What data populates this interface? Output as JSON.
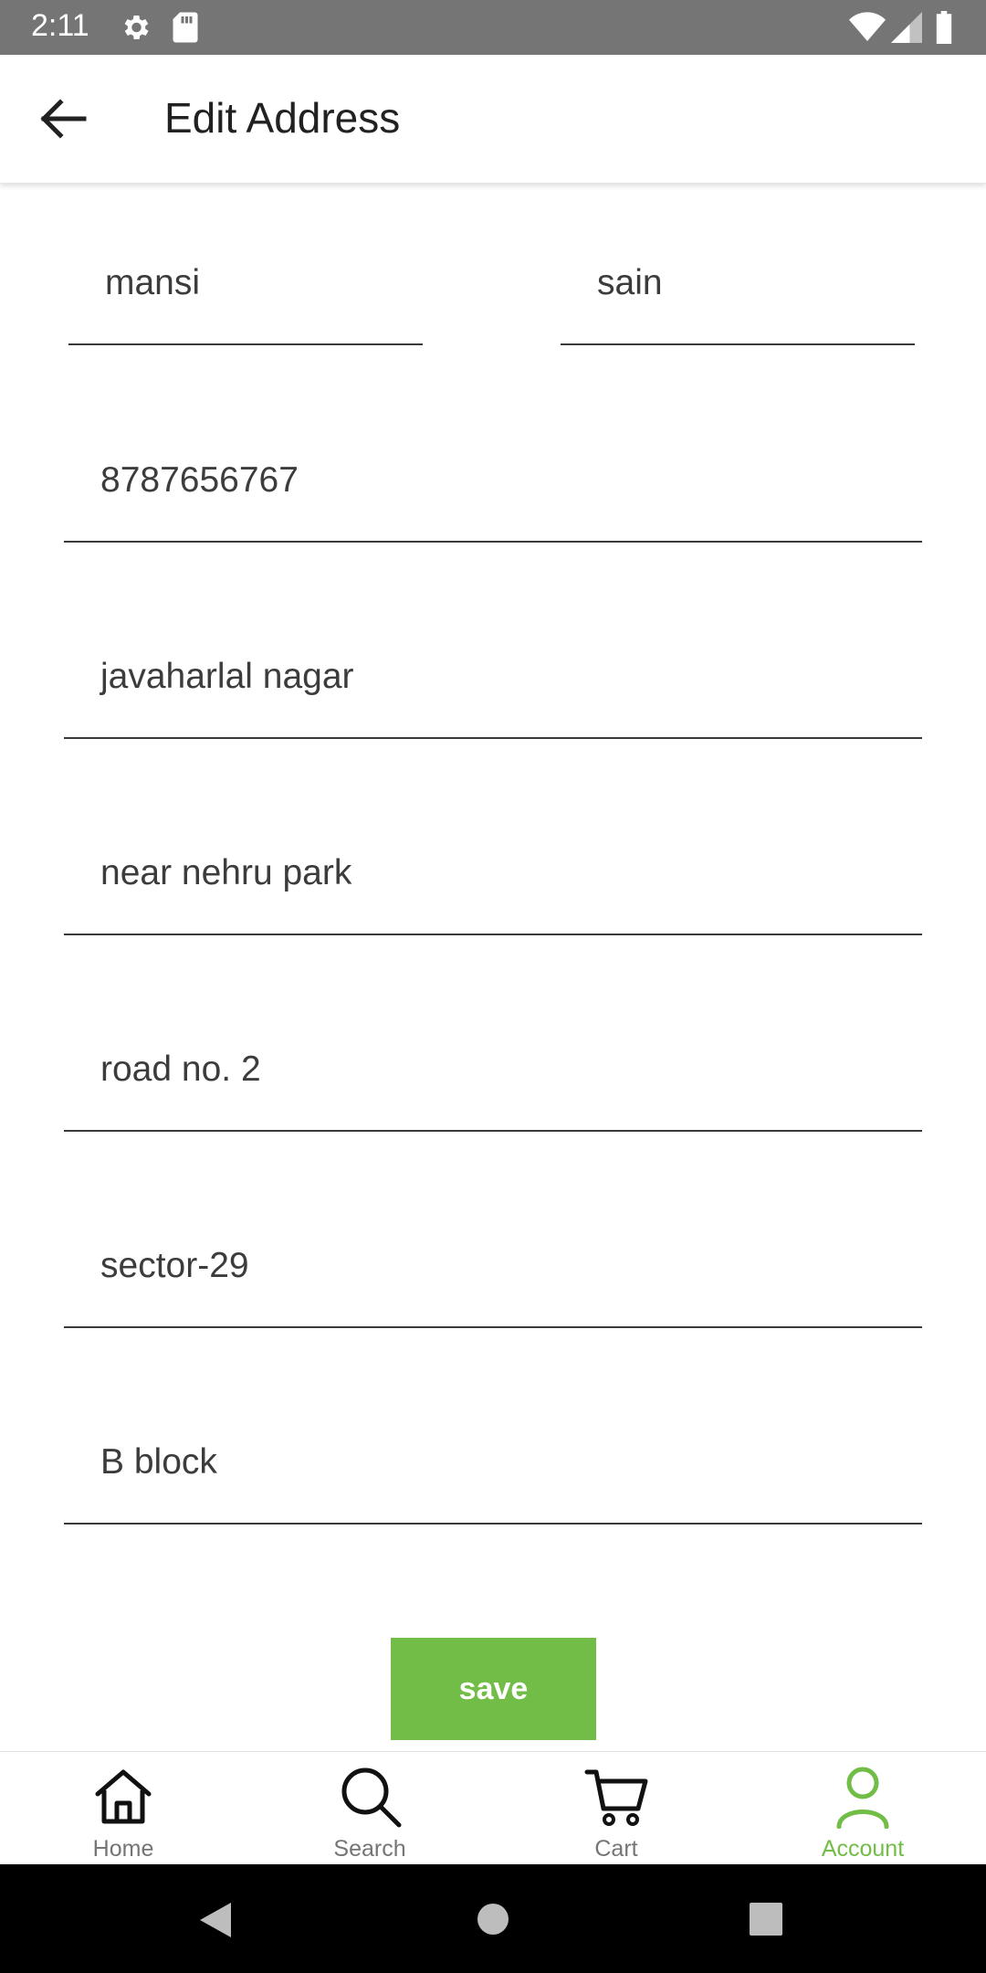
{
  "status_bar": {
    "time": "2:11"
  },
  "app_bar": {
    "title": "Edit Address"
  },
  "form": {
    "first_name": "mansi",
    "last_name": "sain",
    "phone": "8787656767",
    "address_line1": "javaharlal nagar",
    "landmark": "near nehru park",
    "road": "road no. 2",
    "sector": "sector-29",
    "block": "B block"
  },
  "save_button": {
    "label": "save"
  },
  "bottom_nav": {
    "items": [
      {
        "label": "Home",
        "icon": "home-icon"
      },
      {
        "label": "Search",
        "icon": "search-icon"
      },
      {
        "label": "Cart",
        "icon": "cart-icon"
      },
      {
        "label": "Account",
        "icon": "account-icon",
        "active": true
      }
    ]
  },
  "colors": {
    "accent": "#72bd47",
    "status_bar": "#757575",
    "system_nav": "#000000"
  }
}
